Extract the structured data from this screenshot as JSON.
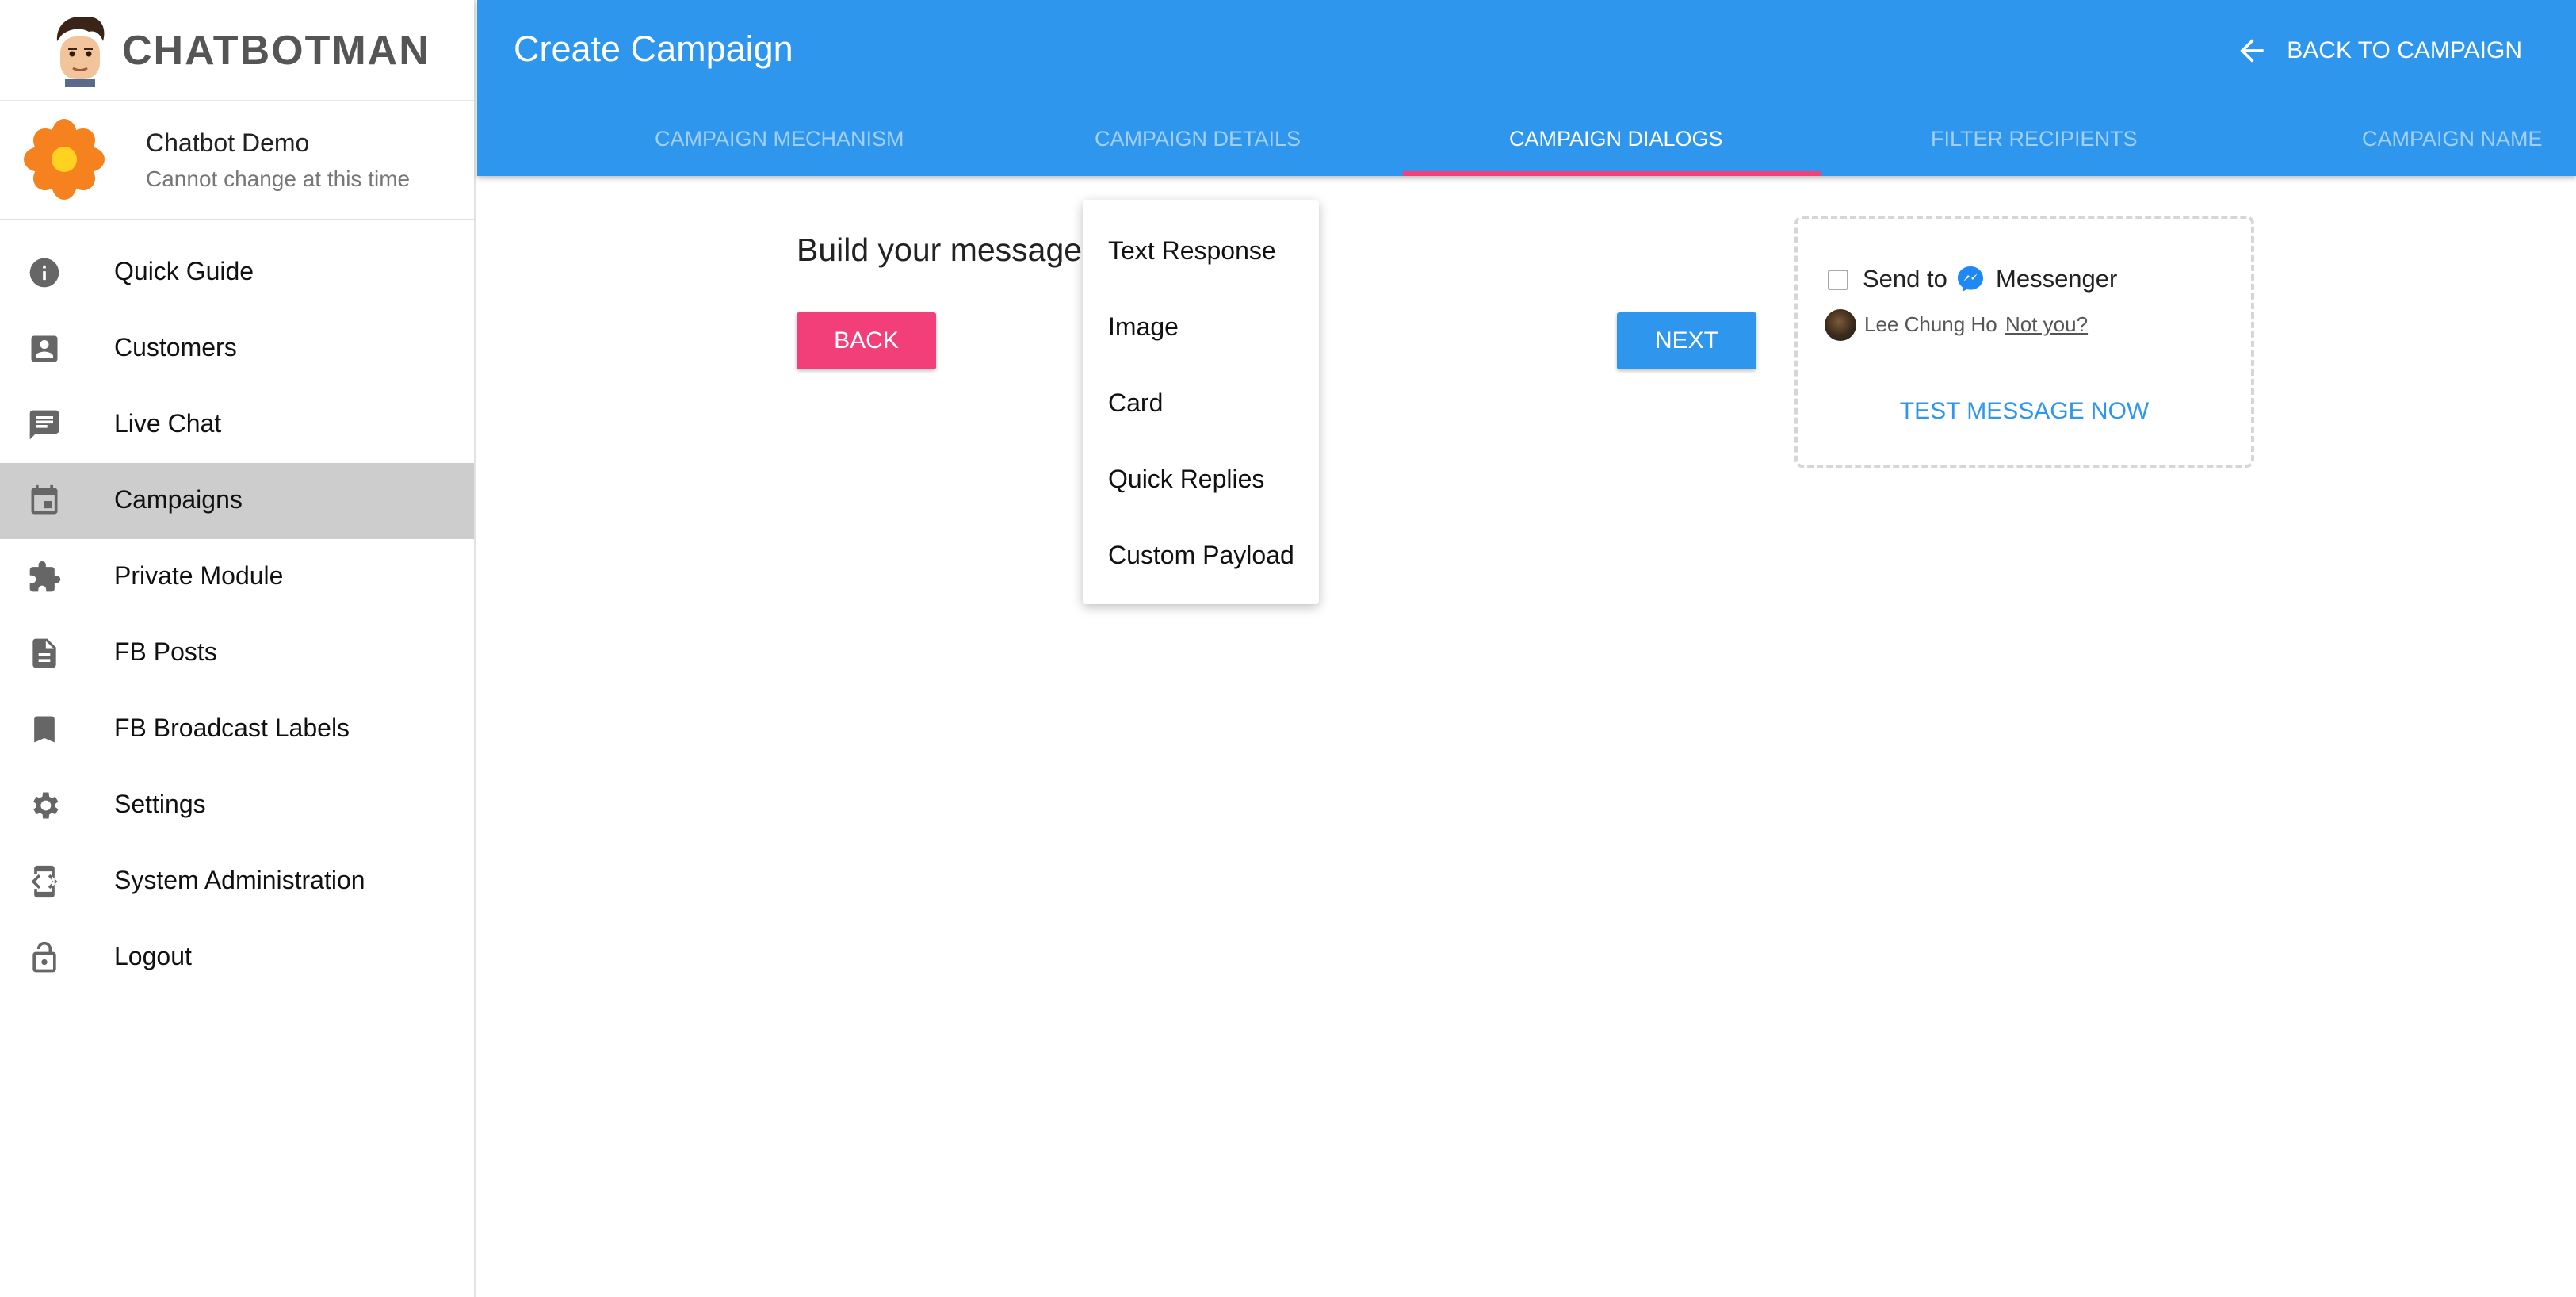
{
  "brand": {
    "name": "CHATBOTMAN",
    "logo_icon": "face-avatar-icon"
  },
  "profile": {
    "name": "Chatbot Demo",
    "subtitle": "Cannot change at this time",
    "icon": "orange-flower-icon"
  },
  "sidebar": {
    "items": [
      {
        "label": "Quick Guide",
        "icon": "info-icon",
        "active": false
      },
      {
        "label": "Customers",
        "icon": "contact-icon",
        "active": false
      },
      {
        "label": "Live Chat",
        "icon": "chat-icon",
        "active": false
      },
      {
        "label": "Campaigns",
        "icon": "calendar-icon",
        "active": true
      },
      {
        "label": "Private Module",
        "icon": "puzzle-icon",
        "active": false
      },
      {
        "label": "FB Posts",
        "icon": "document-icon",
        "active": false
      },
      {
        "label": "FB Broadcast Labels",
        "icon": "bookmark-icon",
        "active": false
      },
      {
        "label": "Settings",
        "icon": "gear-icon",
        "active": false
      },
      {
        "label": "System Administration",
        "icon": "developer-icon",
        "active": false
      },
      {
        "label": "Logout",
        "icon": "lock-icon",
        "active": false
      }
    ]
  },
  "header": {
    "title": "Create Campaign",
    "back_label": "BACK TO CAMPAIGN",
    "tabs": [
      {
        "label": "CAMPAIGN MECHANISM",
        "active": false
      },
      {
        "label": "CAMPAIGN DETAILS",
        "active": false
      },
      {
        "label": "CAMPAIGN DIALOGS",
        "active": true
      },
      {
        "label": "FILTER RECIPIENTS",
        "active": false
      },
      {
        "label": "CAMPAIGN NAME",
        "active": false
      }
    ]
  },
  "main": {
    "build_text": "Build your message",
    "back_label": "BACK",
    "next_label": "NEXT"
  },
  "menu": {
    "items": [
      "Text Response",
      "Image",
      "Card",
      "Quick Replies",
      "Custom Payload"
    ]
  },
  "test_panel": {
    "send_to": "Send to",
    "channel": "Messenger",
    "user_name": "Lee Chung Ho",
    "not_you": "Not you?",
    "test_now": "TEST MESSAGE NOW",
    "checked": false
  },
  "colors": {
    "primary": "#2f96ee",
    "accent": "#f23f7a",
    "active_nav_bg": "#cdcdcd"
  }
}
